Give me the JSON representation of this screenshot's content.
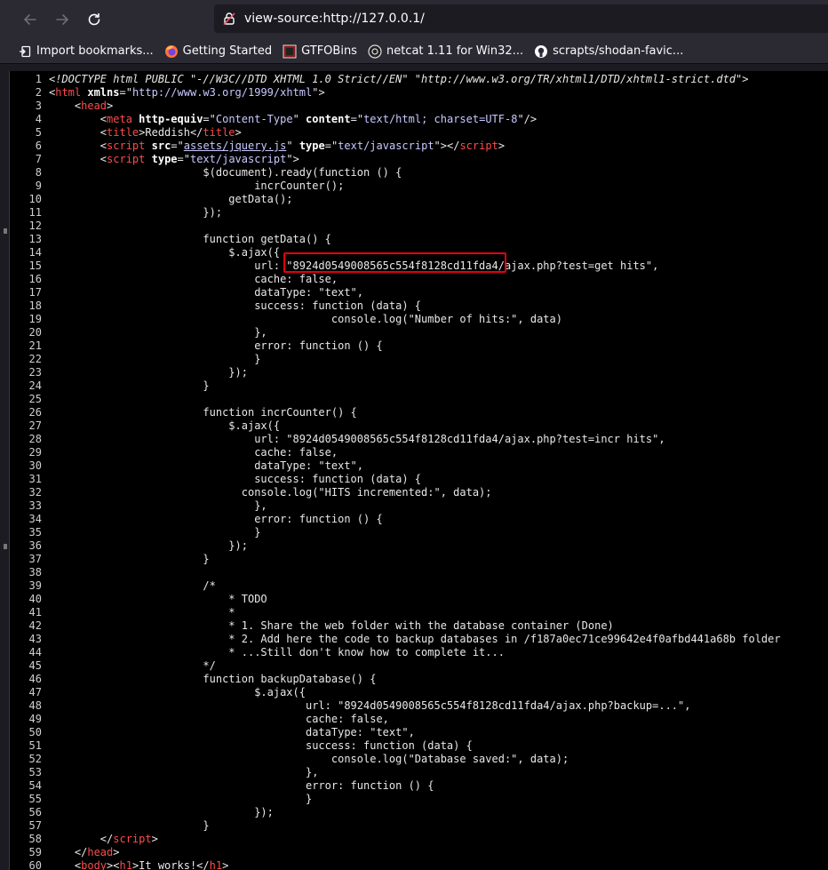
{
  "url": "view-source:http://127.0.0.1/",
  "bookmarks": [
    {
      "label": "Import bookmarks...",
      "icon": "import-icon"
    },
    {
      "label": "Getting Started",
      "icon": "firefox-icon"
    },
    {
      "label": "GTFOBins",
      "icon": "gtfobins-icon"
    },
    {
      "label": "netcat 1.11 for Win32...",
      "icon": "netcat-icon"
    },
    {
      "label": "scrapts/shodan-favic...",
      "icon": "github-icon"
    }
  ],
  "source_lines": [
    {
      "n": "1",
      "parts": [
        [
          "doc",
          "<!DOCTYPE html PUBLIC \"-//W3C//DTD XHTML 1.0 Strict//EN\" \"http://www.w3.org/TR/xhtml1/DTD/xhtml1-strict.dtd\">"
        ]
      ]
    },
    {
      "n": "2",
      "parts": [
        [
          "txt",
          "<"
        ],
        [
          "tag",
          "html"
        ],
        [
          "txt",
          " "
        ],
        [
          "attr",
          "xmlns"
        ],
        [
          "txt",
          "=\""
        ],
        [
          "val",
          "http://www.w3.org/1999/xhtml"
        ],
        [
          "txt",
          "\">"
        ]
      ]
    },
    {
      "n": "3",
      "parts": [
        [
          "txt",
          "    <"
        ],
        [
          "tag",
          "head"
        ],
        [
          "txt",
          ">"
        ]
      ]
    },
    {
      "n": "4",
      "parts": [
        [
          "txt",
          "        <"
        ],
        [
          "tag",
          "meta"
        ],
        [
          "txt",
          " "
        ],
        [
          "attr",
          "http-equiv"
        ],
        [
          "txt",
          "=\""
        ],
        [
          "val",
          "Content-Type"
        ],
        [
          "txt",
          "\" "
        ],
        [
          "attr",
          "content"
        ],
        [
          "txt",
          "=\""
        ],
        [
          "val",
          "text/html; charset=UTF-8"
        ],
        [
          "txt",
          "\"/>"
        ]
      ]
    },
    {
      "n": "5",
      "parts": [
        [
          "txt",
          "        <"
        ],
        [
          "tag",
          "title"
        ],
        [
          "txt",
          ">Reddish</"
        ],
        [
          "tag",
          "title"
        ],
        [
          "txt",
          ">"
        ]
      ]
    },
    {
      "n": "6",
      "parts": [
        [
          "txt",
          "        <"
        ],
        [
          "tag",
          "script"
        ],
        [
          "txt",
          " "
        ],
        [
          "attr",
          "src"
        ],
        [
          "txt",
          "=\""
        ],
        [
          "link",
          "assets/jquery.js"
        ],
        [
          "txt",
          "\" "
        ],
        [
          "attr",
          "type"
        ],
        [
          "txt",
          "=\""
        ],
        [
          "val",
          "text/javascript"
        ],
        [
          "txt",
          "\"></"
        ],
        [
          "tag",
          "script"
        ],
        [
          "txt",
          ">"
        ]
      ]
    },
    {
      "n": "7",
      "parts": [
        [
          "txt",
          "        <"
        ],
        [
          "tag",
          "script"
        ],
        [
          "txt",
          " "
        ],
        [
          "attr",
          "type"
        ],
        [
          "txt",
          "=\""
        ],
        [
          "val",
          "text/javascript"
        ],
        [
          "txt",
          "\">"
        ]
      ]
    },
    {
      "n": "8",
      "parts": [
        [
          "txt",
          "                        $(document).ready(function () {"
        ]
      ]
    },
    {
      "n": "9",
      "parts": [
        [
          "txt",
          "                                incrCounter();"
        ]
      ]
    },
    {
      "n": "10",
      "parts": [
        [
          "txt",
          "                            getData();"
        ]
      ]
    },
    {
      "n": "11",
      "parts": [
        [
          "txt",
          "                        });"
        ]
      ]
    },
    {
      "n": "12",
      "parts": [
        [
          "txt",
          ""
        ]
      ]
    },
    {
      "n": "13",
      "parts": [
        [
          "txt",
          "                        function getData() {"
        ]
      ]
    },
    {
      "n": "14",
      "parts": [
        [
          "txt",
          "                            $.ajax({"
        ]
      ]
    },
    {
      "n": "15",
      "parts": [
        [
          "txt",
          "                                url: \"8924d0549008565c554f8128cd11fda4/ajax.php?test=get hits\","
        ]
      ]
    },
    {
      "n": "16",
      "parts": [
        [
          "txt",
          "                                cache: false,"
        ]
      ]
    },
    {
      "n": "17",
      "parts": [
        [
          "txt",
          "                                dataType: \"text\","
        ]
      ]
    },
    {
      "n": "18",
      "parts": [
        [
          "txt",
          "                                success: function (data) {"
        ]
      ]
    },
    {
      "n": "19",
      "parts": [
        [
          "txt",
          "                                            console.log(\"Number of hits:\", data)"
        ]
      ]
    },
    {
      "n": "20",
      "parts": [
        [
          "txt",
          "                                },"
        ]
      ]
    },
    {
      "n": "21",
      "parts": [
        [
          "txt",
          "                                error: function () {"
        ]
      ]
    },
    {
      "n": "22",
      "parts": [
        [
          "txt",
          "                                }"
        ]
      ]
    },
    {
      "n": "23",
      "parts": [
        [
          "txt",
          "                            });"
        ]
      ]
    },
    {
      "n": "24",
      "parts": [
        [
          "txt",
          "                        }"
        ]
      ]
    },
    {
      "n": "25",
      "parts": [
        [
          "txt",
          ""
        ]
      ]
    },
    {
      "n": "26",
      "parts": [
        [
          "txt",
          "                        function incrCounter() {"
        ]
      ]
    },
    {
      "n": "27",
      "parts": [
        [
          "txt",
          "                            $.ajax({"
        ]
      ]
    },
    {
      "n": "28",
      "parts": [
        [
          "txt",
          "                                url: \"8924d0549008565c554f8128cd11fda4/ajax.php?test=incr hits\","
        ]
      ]
    },
    {
      "n": "29",
      "parts": [
        [
          "txt",
          "                                cache: false,"
        ]
      ]
    },
    {
      "n": "30",
      "parts": [
        [
          "txt",
          "                                dataType: \"text\","
        ]
      ]
    },
    {
      "n": "31",
      "parts": [
        [
          "txt",
          "                                success: function (data) {"
        ]
      ]
    },
    {
      "n": "32",
      "parts": [
        [
          "txt",
          "                              console.log(\"HITS incremented:\", data);"
        ]
      ]
    },
    {
      "n": "33",
      "parts": [
        [
          "txt",
          "                                },"
        ]
      ]
    },
    {
      "n": "34",
      "parts": [
        [
          "txt",
          "                                error: function () {"
        ]
      ]
    },
    {
      "n": "35",
      "parts": [
        [
          "txt",
          "                                }"
        ]
      ]
    },
    {
      "n": "36",
      "parts": [
        [
          "txt",
          "                            });"
        ]
      ]
    },
    {
      "n": "37",
      "parts": [
        [
          "txt",
          "                        }"
        ]
      ]
    },
    {
      "n": "38",
      "parts": [
        [
          "txt",
          ""
        ]
      ]
    },
    {
      "n": "39",
      "parts": [
        [
          "txt",
          "                        /*"
        ]
      ]
    },
    {
      "n": "40",
      "parts": [
        [
          "txt",
          "                            * TODO"
        ]
      ]
    },
    {
      "n": "41",
      "parts": [
        [
          "txt",
          "                            *"
        ]
      ]
    },
    {
      "n": "42",
      "parts": [
        [
          "txt",
          "                            * 1. Share the web folder with the database container (Done)"
        ]
      ]
    },
    {
      "n": "43",
      "parts": [
        [
          "txt",
          "                            * 2. Add here the code to backup databases in /f187a0ec71ce99642e4f0afbd441a68b folder"
        ]
      ]
    },
    {
      "n": "44",
      "parts": [
        [
          "txt",
          "                            * ...Still don't know how to complete it..."
        ]
      ]
    },
    {
      "n": "45",
      "parts": [
        [
          "txt",
          "                        */"
        ]
      ]
    },
    {
      "n": "46",
      "parts": [
        [
          "txt",
          "                        function backupDatabase() {"
        ]
      ]
    },
    {
      "n": "47",
      "parts": [
        [
          "txt",
          "                                $.ajax({"
        ]
      ]
    },
    {
      "n": "48",
      "parts": [
        [
          "txt",
          "                                        url: \"8924d0549008565c554f8128cd11fda4/ajax.php?backup=...\","
        ]
      ]
    },
    {
      "n": "49",
      "parts": [
        [
          "txt",
          "                                        cache: false,"
        ]
      ]
    },
    {
      "n": "50",
      "parts": [
        [
          "txt",
          "                                        dataType: \"text\","
        ]
      ]
    },
    {
      "n": "51",
      "parts": [
        [
          "txt",
          "                                        success: function (data) {"
        ]
      ]
    },
    {
      "n": "52",
      "parts": [
        [
          "txt",
          "                                            console.log(\"Database saved:\", data);"
        ]
      ]
    },
    {
      "n": "53",
      "parts": [
        [
          "txt",
          "                                        },"
        ]
      ]
    },
    {
      "n": "54",
      "parts": [
        [
          "txt",
          "                                        error: function () {"
        ]
      ]
    },
    {
      "n": "55",
      "parts": [
        [
          "txt",
          "                                        }"
        ]
      ]
    },
    {
      "n": "56",
      "parts": [
        [
          "txt",
          "                                });"
        ]
      ]
    },
    {
      "n": "57",
      "parts": [
        [
          "txt",
          "                        }"
        ]
      ]
    },
    {
      "n": "58",
      "parts": [
        [
          "txt",
          "        </"
        ],
        [
          "tag",
          "script"
        ],
        [
          "txt",
          ">"
        ]
      ]
    },
    {
      "n": "59",
      "parts": [
        [
          "txt",
          "    </"
        ],
        [
          "tag",
          "head"
        ],
        [
          "txt",
          ">"
        ]
      ]
    },
    {
      "n": "60",
      "parts": [
        [
          "txt",
          "    <"
        ],
        [
          "tag",
          "body"
        ],
        [
          "txt",
          "><"
        ],
        [
          "tag",
          "h1"
        ],
        [
          "txt",
          ">It works!</"
        ],
        [
          "tag",
          "h1"
        ],
        [
          "txt",
          ">"
        ]
      ]
    }
  ],
  "colors": {
    "toolbar": "#2b2a33",
    "source_bg": "#000000",
    "tag": "#ff4b4b",
    "value": "#c8c8ff",
    "highlight": "#e4000f"
  }
}
